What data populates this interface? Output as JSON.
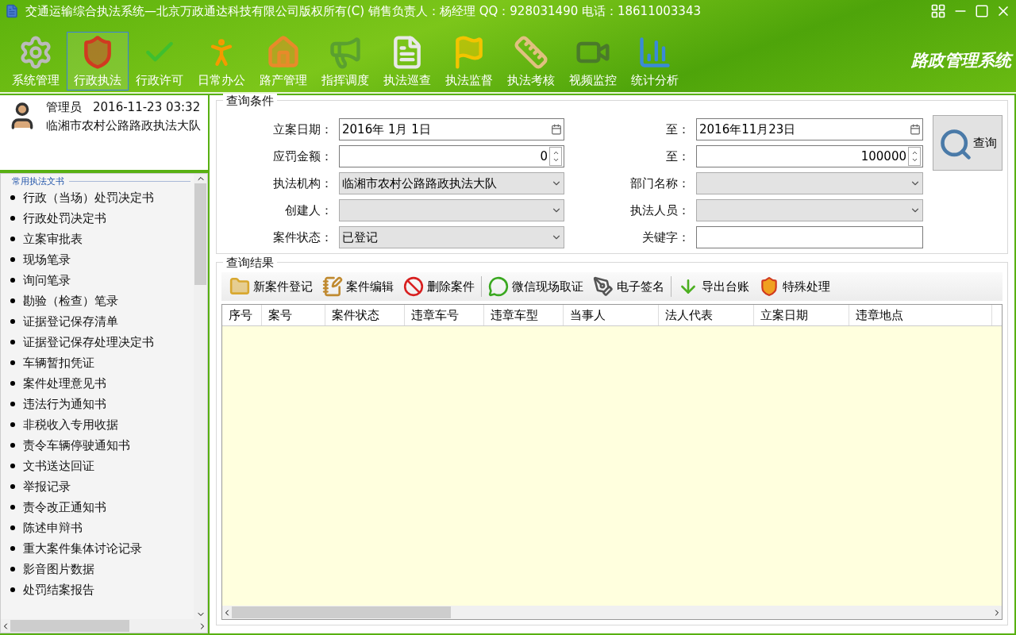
{
  "window": {
    "title": "交通运输综合执法系统—北京万政通达科技有限公司版权所有(C) 销售负责人：杨经理 QQ：928031490 电话：18611003343",
    "brand": "路政管理系统"
  },
  "nav": [
    {
      "label": "系统管理",
      "selected": false
    },
    {
      "label": "行政执法",
      "selected": true
    },
    {
      "label": "行政许可",
      "selected": false
    },
    {
      "label": "日常办公",
      "selected": false
    },
    {
      "label": "路产管理",
      "selected": false
    },
    {
      "label": "指挥调度",
      "selected": false
    },
    {
      "label": "执法巡查",
      "selected": false
    },
    {
      "label": "执法监督",
      "selected": false
    },
    {
      "label": "执法考核",
      "selected": false
    },
    {
      "label": "视频监控",
      "selected": false
    },
    {
      "label": "统计分析",
      "selected": false
    }
  ],
  "user": {
    "role": "管理员",
    "time": "2016-11-23 03:32",
    "unit": "临湘市农村公路路政执法大队"
  },
  "documents": {
    "title": "常用执法文书",
    "items": [
      "行政（当场）处罚决定书",
      "行政处罚决定书",
      "立案审批表",
      "现场笔录",
      "询问笔录",
      "勘验（检查）笔录",
      "证据登记保存清单",
      "证据登记保存处理决定书",
      "车辆暂扣凭证",
      "案件处理意见书",
      "违法行为通知书",
      "非税收入专用收据",
      "责令车辆停驶通知书",
      "文书送达回证",
      "举报记录",
      "责令改正通知书",
      "陈述申辩书",
      "重大案件集体讨论记录",
      "影音图片数据",
      "处罚结案报告"
    ]
  },
  "query": {
    "title": "查询条件",
    "fields": [
      {
        "label": "立案日期：",
        "kind": "date",
        "value": "2016年  1月  1日"
      },
      {
        "label": "至：",
        "kind": "date",
        "value": "2016年11月23日"
      },
      {
        "label": "应罚金额：",
        "kind": "number",
        "value": "0"
      },
      {
        "label": "至：",
        "kind": "number",
        "value": "100000"
      },
      {
        "label": "执法机构：",
        "kind": "select",
        "value": "临湘市农村公路路政执法大队"
      },
      {
        "label": "部门名称：",
        "kind": "select"
      },
      {
        "label": "创建人：",
        "kind": "select"
      },
      {
        "label": "执法人员：",
        "kind": "select"
      },
      {
        "label": "案件状态：",
        "kind": "select",
        "value": "已登记"
      },
      {
        "label": "关键字：",
        "kind": "text"
      }
    ],
    "button": "查询"
  },
  "results": {
    "title": "查询结果",
    "actions": [
      {
        "label": "新案件登记",
        "divider_before": false
      },
      {
        "label": "案件编辑",
        "divider_before": false
      },
      {
        "label": "删除案件",
        "divider_before": false
      },
      {
        "label": "微信现场取证",
        "divider_before": true
      },
      {
        "label": "电子签名",
        "divider_before": false
      },
      {
        "label": "导出台账",
        "divider_before": true
      },
      {
        "label": "特殊处理",
        "divider_before": false
      }
    ],
    "table": {
      "columns": [
        "序号",
        "案号",
        "案件状态",
        "违章车号",
        "违章车型",
        "当事人",
        "法人代表",
        "立案日期",
        "违章地点"
      ]
    }
  }
}
